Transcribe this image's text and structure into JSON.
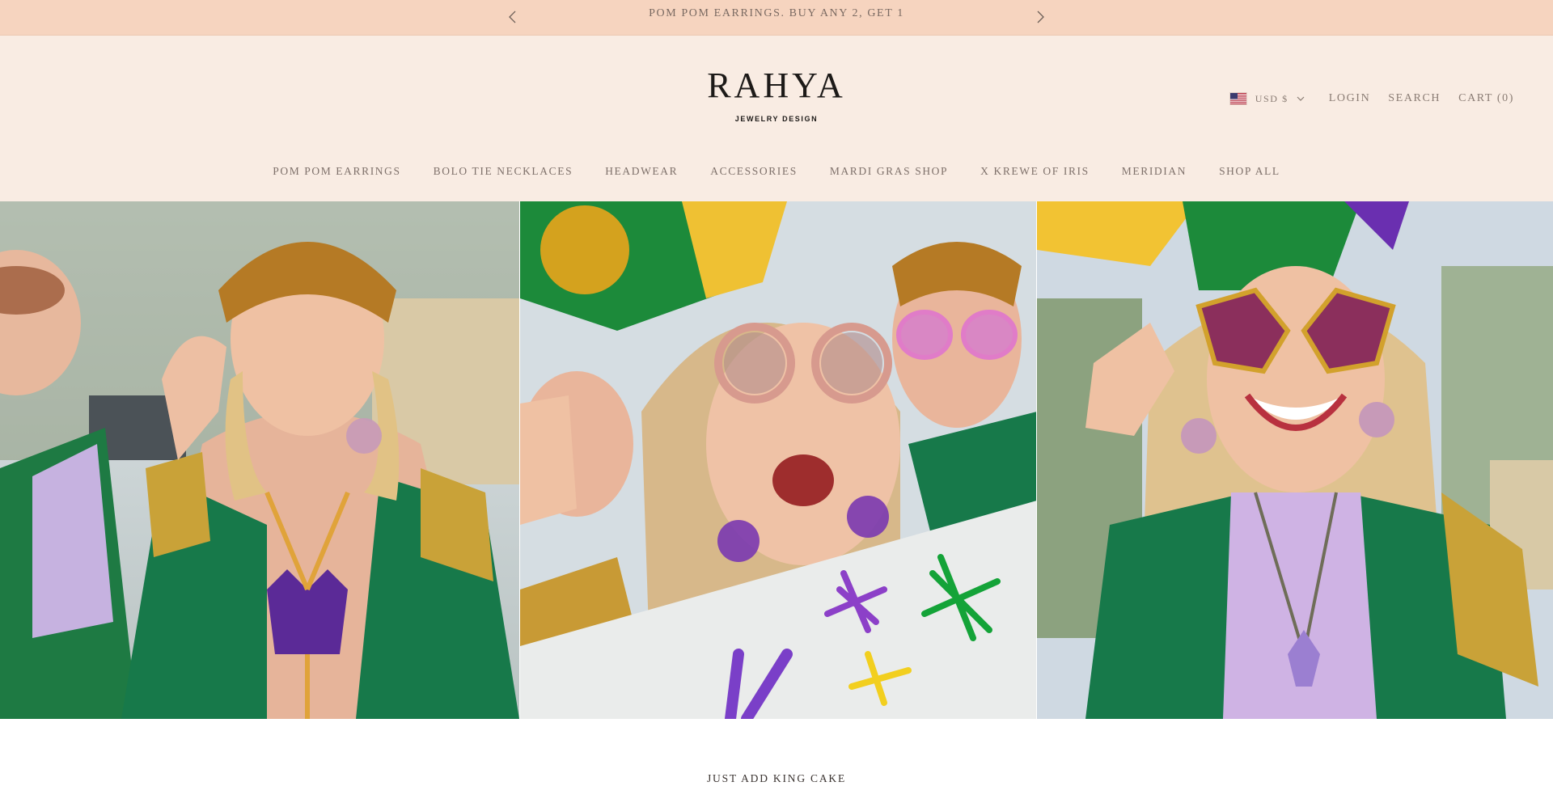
{
  "announcement": {
    "text": "POM POM EARRINGS. BUY ANY 2, GET 1",
    "prev_icon": "chevron-left-icon",
    "next_icon": "chevron-right-icon"
  },
  "brand": {
    "name": "RAHYA",
    "tagline": "JEWELRY DESIGN"
  },
  "utility_nav": {
    "currency": "USD $",
    "login": "LOGIN",
    "search": "SEARCH",
    "cart": "CART (0)"
  },
  "main_nav": [
    {
      "label": "POM POM EARRINGS"
    },
    {
      "label": "BOLO TIE NECKLACES"
    },
    {
      "label": "HEADWEAR"
    },
    {
      "label": "ACCESSORIES"
    },
    {
      "label": "MARDI GRAS SHOP"
    },
    {
      "label": "X KREWE OF IRIS"
    },
    {
      "label": "MERIDIAN"
    },
    {
      "label": "SHOP ALL"
    }
  ],
  "section": {
    "title": "JUST ADD KING CAKE"
  },
  "colors": {
    "announcement_bg": "#f6d4bf",
    "header_bg": "#f9ece3",
    "text": "#7a6a62",
    "mardi_purple": "#6a2fb0",
    "mardi_green": "#138a3a",
    "mardi_gold": "#d8a31a"
  }
}
